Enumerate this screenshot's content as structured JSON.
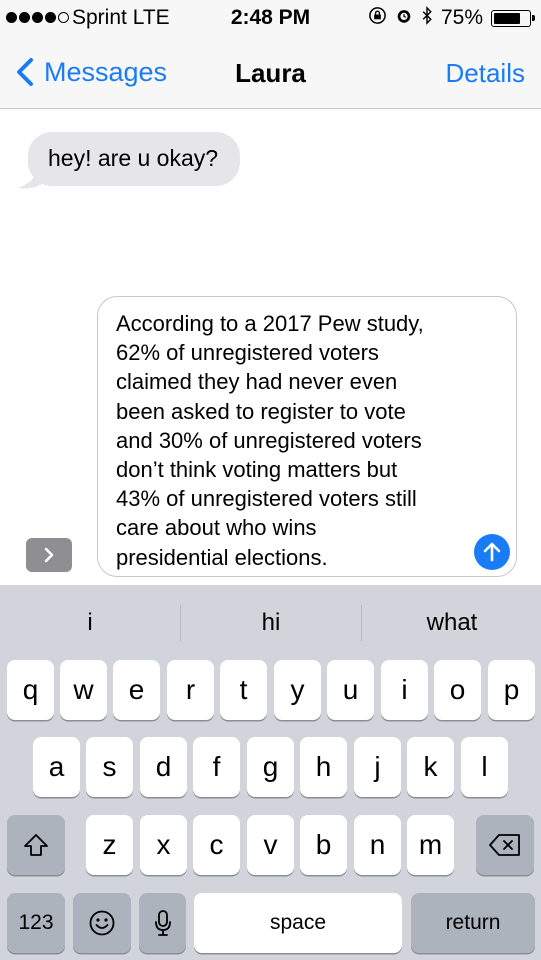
{
  "status": {
    "carrier": "Sprint",
    "network": "LTE",
    "time": "2:48 PM",
    "battery": "75%",
    "battery_level": 0.75
  },
  "nav": {
    "back_label": "Messages",
    "title": "Laura",
    "details_label": "Details"
  },
  "messages": [
    {
      "text": "hey! are u okay?"
    }
  ],
  "compose": {
    "lines": [
      "According to a 2017 Pew study,",
      "62% of unregistered voters",
      "claimed they had never even",
      "been asked to register to vote",
      "and 30% of unregistered voters",
      "don’t think voting matters but",
      "43% of unregistered voters still",
      "care about who wins",
      "presidential elections."
    ]
  },
  "keyboard": {
    "suggestions": [
      "i",
      "hi",
      "what"
    ],
    "row1": [
      "q",
      "w",
      "e",
      "r",
      "t",
      "y",
      "u",
      "i",
      "o",
      "p"
    ],
    "row2": [
      "a",
      "s",
      "d",
      "f",
      "g",
      "h",
      "j",
      "k",
      "l"
    ],
    "row3": [
      "z",
      "x",
      "c",
      "v",
      "b",
      "n",
      "m"
    ],
    "numbers_label": "123",
    "space_label": "space",
    "return_label": "return"
  }
}
